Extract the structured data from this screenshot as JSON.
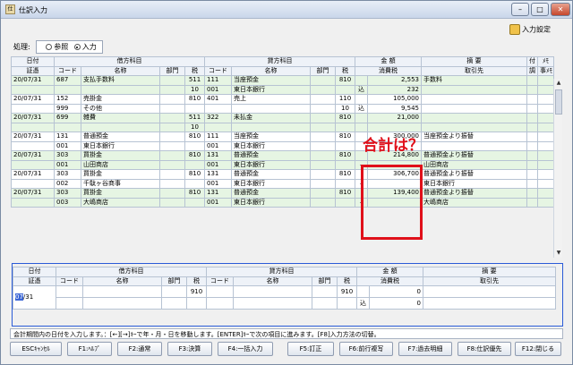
{
  "window": {
    "title": "仕訳入力",
    "minimize": "–",
    "maximize": "□",
    "close": "✕"
  },
  "toolbar": {
    "setting_label": "入力設定"
  },
  "mode": {
    "label": "処理:",
    "options": [
      "参照",
      "入力"
    ],
    "selected": 1
  },
  "headers": {
    "row1": {
      "date": "日付",
      "debit": "借方科目",
      "credit": "貸方科目",
      "amount": "金 額",
      "memo": "摘 要",
      "attach": "付",
      "note": "ﾒﾓ"
    },
    "row2": {
      "voucher": "証憑",
      "code": "コード",
      "name": "名称",
      "dept": "部門",
      "tax": "税",
      "code2": "コード",
      "name2": "名称",
      "dept2": "部門",
      "tax2": "税",
      "taxamt": "消費税",
      "partner": "取引先",
      "attach2": "調",
      "note2": "事ﾒﾓ"
    }
  },
  "entries": [
    {
      "date": "20/07/31",
      "dcode": "687",
      "dname": "支払手数料",
      "ddept": "",
      "dtax": "511",
      "ccode": "111",
      "cname": "当座預金",
      "cdept": "",
      "ctax": "810",
      "mark": "",
      "amount": "2,553",
      "memo": "手数料",
      "sub": {
        "dcode": "",
        "dname": "",
        "dtax": "10",
        "ccode": "001",
        "cname": "東日本銀行",
        "ctax": "",
        "mark": "込",
        "amount": "232",
        "memo": ""
      }
    },
    {
      "date": "20/07/31",
      "dcode": "152",
      "dname": "売掛金",
      "ddept": "",
      "dtax": "810",
      "ccode": "401",
      "cname": "売上",
      "cdept": "",
      "ctax": "110",
      "mark": "",
      "amount": "105,000",
      "memo": "",
      "sub": {
        "dcode": "999",
        "dname": "その他",
        "dtax": "",
        "ccode": "",
        "cname": "",
        "ctax": "10",
        "mark": "込",
        "amount": "9,545",
        "memo": ""
      }
    },
    {
      "date": "20/07/31",
      "dcode": "699",
      "dname": "雑費",
      "ddept": "",
      "dtax": "511",
      "ccode": "322",
      "cname": "未払金",
      "cdept": "",
      "ctax": "810",
      "mark": "",
      "amount": "21,000",
      "memo": "",
      "sub": {
        "dcode": "",
        "dname": "",
        "dtax": "10",
        "ccode": "",
        "cname": "",
        "ctax": "",
        "mark": "",
        "amount": "",
        "memo": ""
      }
    },
    {
      "date": "20/07/31",
      "dcode": "131",
      "dname": "普通預金",
      "ddept": "",
      "dtax": "810",
      "ccode": "111",
      "cname": "当座預金",
      "cdept": "",
      "ctax": "810",
      "mark": "",
      "amount": "300,000",
      "memo": "当座預金より振替",
      "sub": {
        "dcode": "001",
        "dname": "東日本銀行",
        "dtax": "",
        "ccode": "001",
        "cname": "東日本銀行",
        "ctax": "",
        "mark": "",
        "amount": "",
        "memo": ""
      }
    },
    {
      "date": "20/07/31",
      "dcode": "303",
      "dname": "買掛金",
      "ddept": "",
      "dtax": "810",
      "ccode": "131",
      "cname": "普通預金",
      "cdept": "",
      "ctax": "810",
      "mark": "",
      "amount": "214,800",
      "memo": "普通預金より振替",
      "sub": {
        "dcode": "001",
        "dname": "山田商店",
        "dtax": "",
        "ccode": "001",
        "cname": "東日本銀行",
        "ctax": "",
        "mark": "–",
        "amount": "",
        "memo": "山田商店"
      }
    },
    {
      "date": "20/07/31",
      "dcode": "303",
      "dname": "買掛金",
      "ddept": "",
      "dtax": "810",
      "ccode": "131",
      "cname": "普通預金",
      "cdept": "",
      "ctax": "810",
      "mark": "",
      "amount": "306,700",
      "memo": "普通預金より振替",
      "sub": {
        "dcode": "002",
        "dname": "千駄ヶ谷商事",
        "dtax": "",
        "ccode": "001",
        "cname": "東日本銀行",
        "ctax": "",
        "mark": "–",
        "amount": "",
        "memo": "東日本銀行"
      }
    },
    {
      "date": "20/07/31",
      "dcode": "303",
      "dname": "買掛金",
      "ddept": "",
      "dtax": "810",
      "ccode": "131",
      "cname": "普通預金",
      "cdept": "",
      "ctax": "810",
      "mark": "",
      "amount": "139,400",
      "memo": "普通預金より振替",
      "sub": {
        "dcode": "003",
        "dname": "大嶋商店",
        "dtax": "",
        "ccode": "001",
        "cname": "東日本銀行",
        "ctax": "",
        "mark": "–",
        "amount": "",
        "memo": "大嶋商店"
      }
    }
  ],
  "input": {
    "date_cursor": "07",
    "date_rest": "/31",
    "dtax": "910",
    "ctax": "910",
    "amount": "0",
    "tax_mark": "込",
    "tax_amount": "0"
  },
  "annotation": {
    "text": "合計は？",
    "color": "#e0101a"
  },
  "status_text": "会計期間内の日付を入力します。：[←][→]ｷｰで年・月・日を移動します。[ENTER]ｷｰで次の項目に進みます。[F8]入力方法の切替。",
  "fkeys": [
    "ESCｷｬﾝｾﾙ",
    "F1:ﾍﾙﾌﾟ",
    "F2:通常",
    "F3:決算",
    "F4:一括入力",
    "F5:訂正",
    "F6:前行複写",
    "F7:過去明細",
    "F8:仕訳優先",
    "F12:閉じる"
  ]
}
